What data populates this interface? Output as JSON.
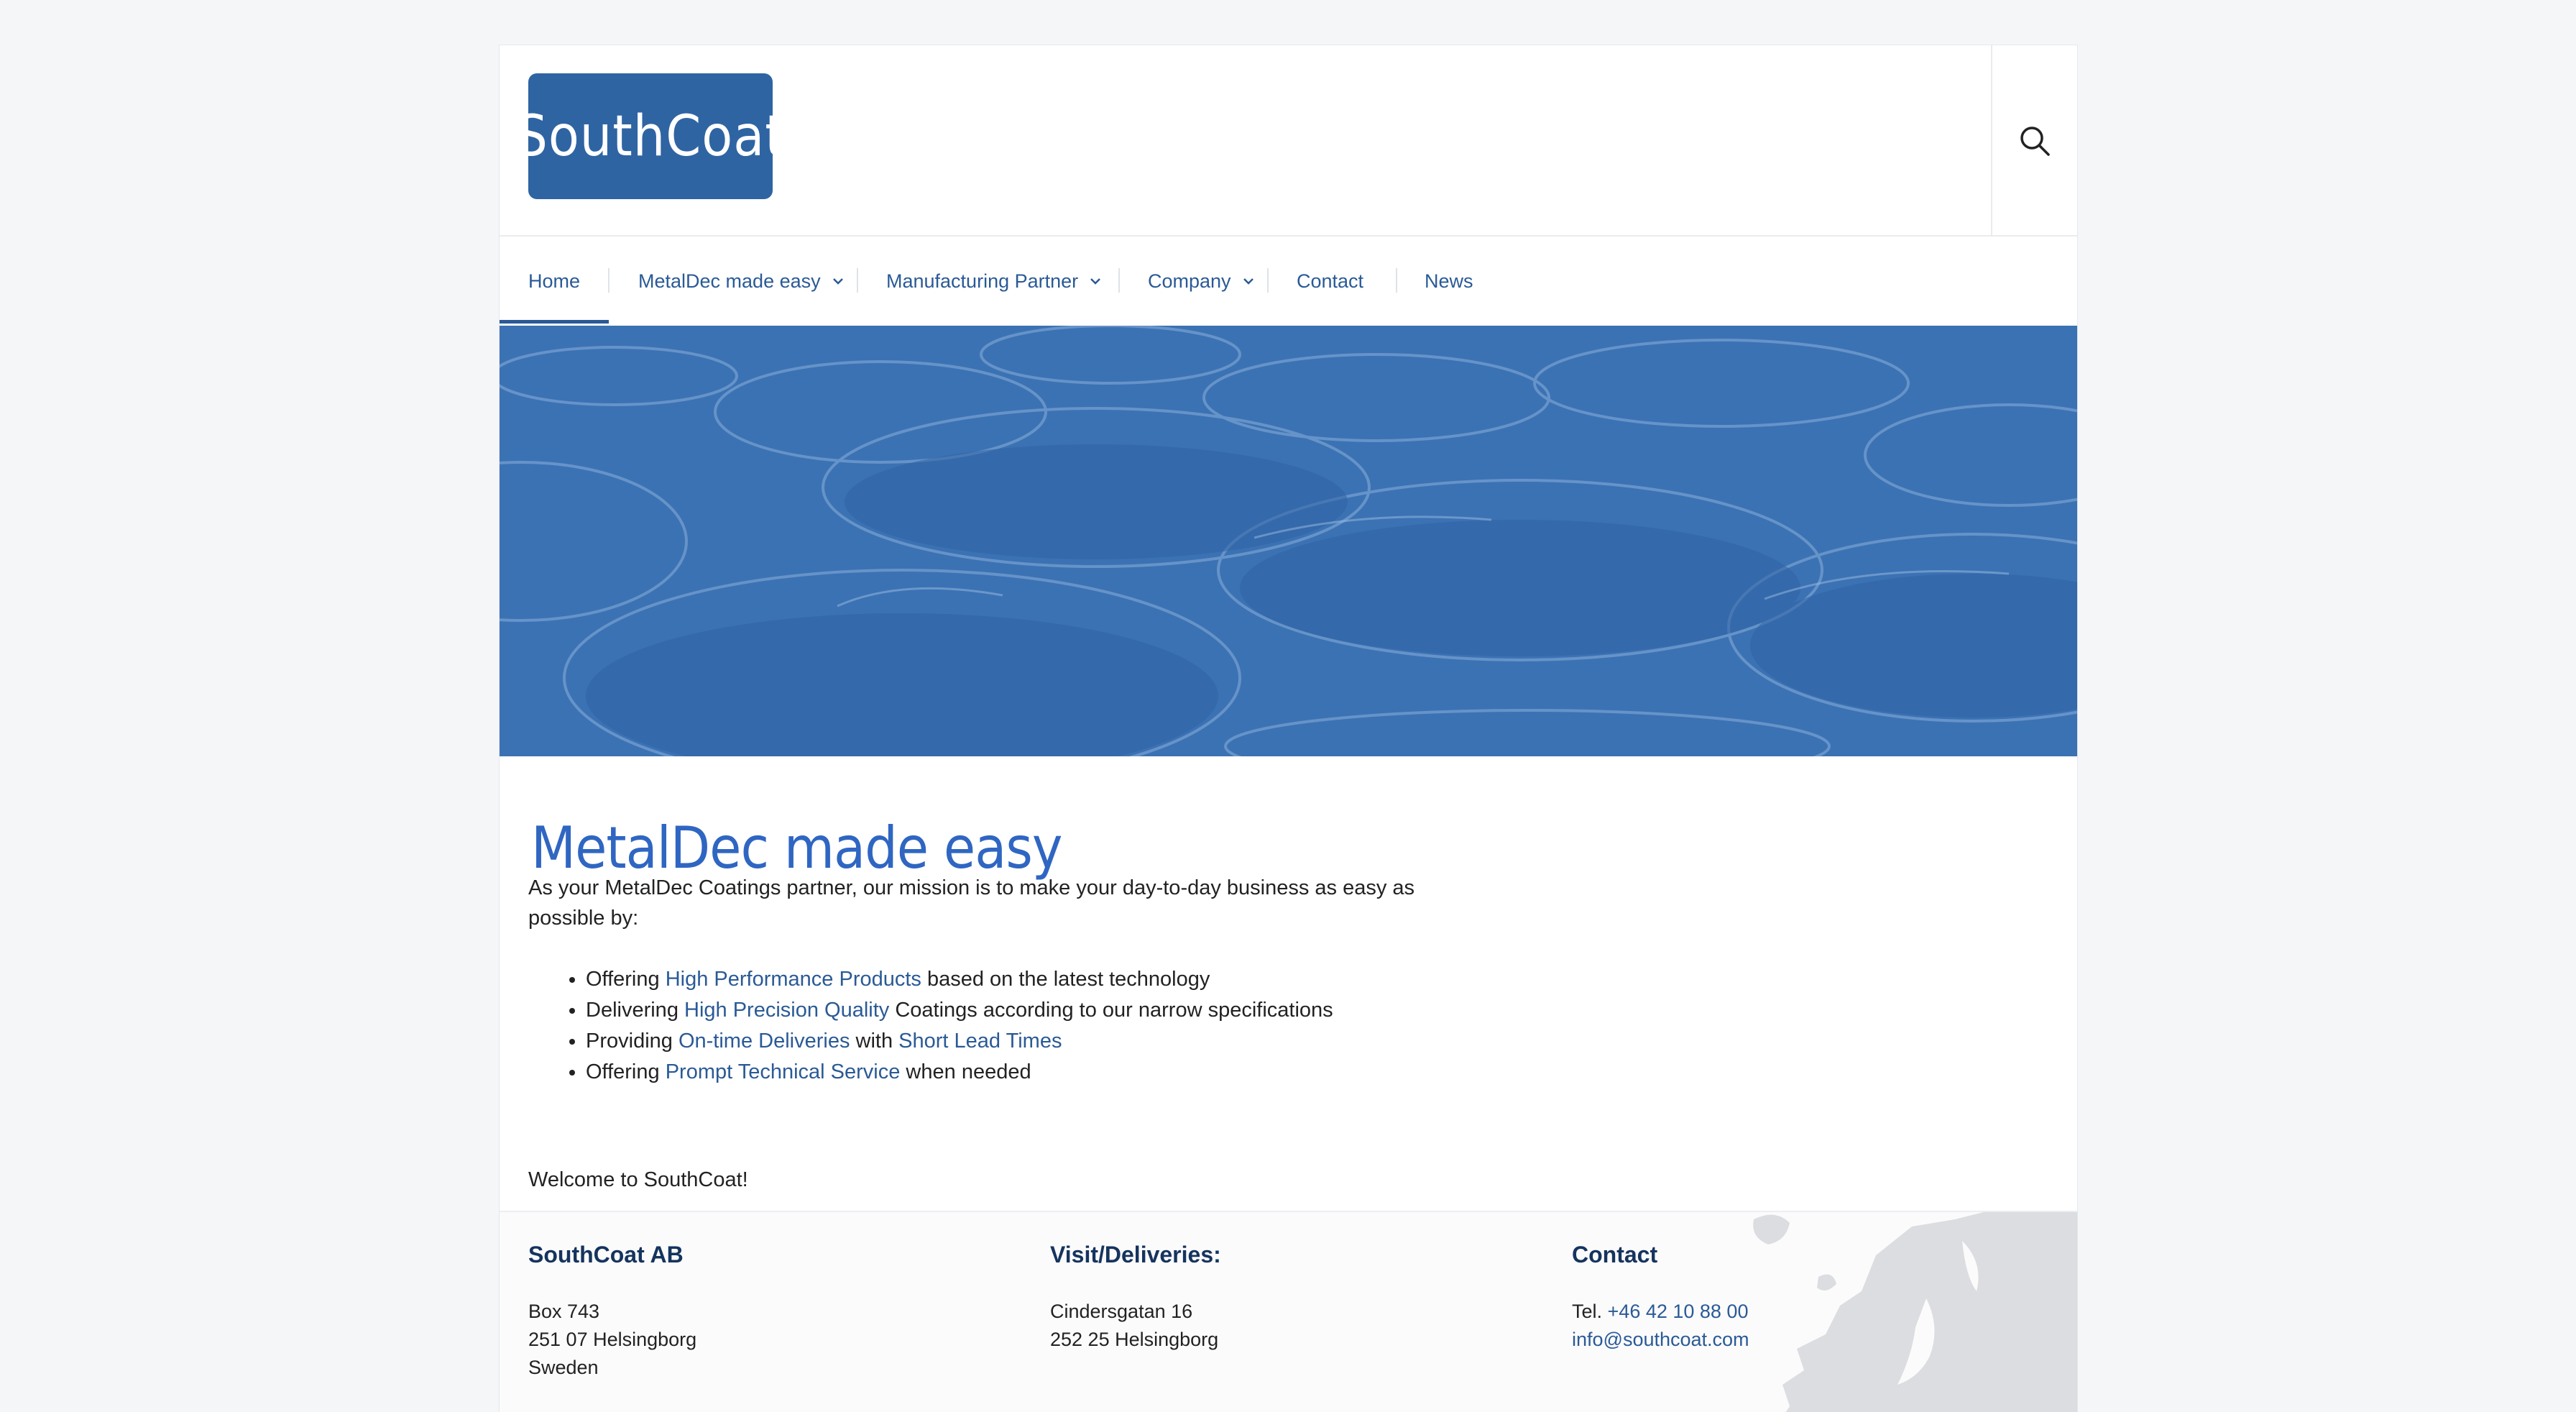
{
  "header": {
    "logo_text": "SouthCoat",
    "search_icon": "search-icon"
  },
  "nav": {
    "items": [
      {
        "label": "Home",
        "has_dropdown": false,
        "active": true
      },
      {
        "label": "MetalDec made easy",
        "has_dropdown": true
      },
      {
        "label": "Manufacturing Partner",
        "has_dropdown": true
      },
      {
        "label": "Company",
        "has_dropdown": true
      },
      {
        "label": "Contact",
        "has_dropdown": false
      },
      {
        "label": "News",
        "has_dropdown": false
      }
    ]
  },
  "main": {
    "title": "MetalDec made easy",
    "intro": "As your MetalDec Coatings partner, our mission is to make your day-to-day business as easy as possible by:",
    "bullets": [
      {
        "prefix": "Offering ",
        "link1": "High Performance Products",
        "middle": " based on the latest technology",
        "link2": "",
        "suffix": ""
      },
      {
        "prefix": "Delivering ",
        "link1": "High Precision Quality",
        "middle": " Coatings according to our narrow specifications",
        "link2": "",
        "suffix": ""
      },
      {
        "prefix": "Providing ",
        "link1": "On-time Deliveries",
        "middle": " with ",
        "link2": "Short Lead Times",
        "suffix": ""
      },
      {
        "prefix": "Offering ",
        "link1": "Prompt Technical Service",
        "middle": " when needed",
        "link2": "",
        "suffix": ""
      }
    ],
    "welcome": "Welcome to SouthCoat!"
  },
  "footer": {
    "company": {
      "heading": "SouthCoat AB",
      "lines": [
        "Box 743",
        "251 07 Helsingborg",
        "Sweden"
      ]
    },
    "visit": {
      "heading": "Visit/Deliveries:",
      "lines": [
        "Cindersgatan 16",
        "252 25 Helsingborg"
      ]
    },
    "contact": {
      "heading": "Contact",
      "tel_label": "Tel. ",
      "phone": "+46 42 10 88 00",
      "email": "info@southcoat.com"
    }
  },
  "colors": {
    "brand": "#2f64a3",
    "link": "#2a5a96",
    "title": "#2f66c2",
    "hero": "#3b72b4"
  }
}
